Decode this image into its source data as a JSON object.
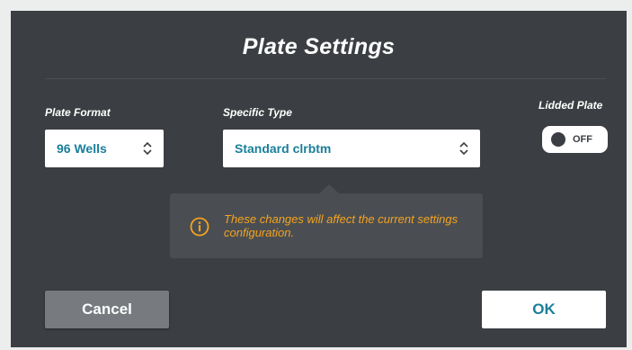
{
  "dialog": {
    "title": "Plate Settings"
  },
  "plate_format": {
    "label": "Plate Format",
    "value": "96 Wells"
  },
  "specific_type": {
    "label": "Specific Type",
    "value": "Standard clrbtm"
  },
  "lidded_plate": {
    "label": "Lidded Plate",
    "state": "OFF"
  },
  "warning": {
    "icon": "info-icon",
    "message": "These changes will affect the current settings configuration."
  },
  "buttons": {
    "cancel": "Cancel",
    "ok": "OK"
  },
  "colors": {
    "dialog_bg": "#3b3e42",
    "accent": "#1a7f9a",
    "warning": "#f4a31f",
    "cancel_bg": "#777b80"
  }
}
